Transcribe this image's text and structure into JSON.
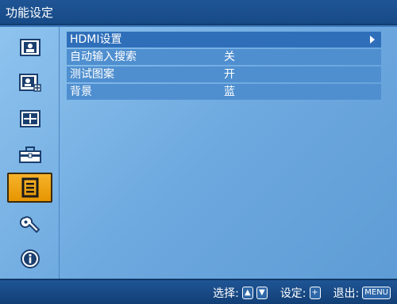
{
  "window": {
    "title": "功能设定"
  },
  "sidebar": {
    "items": [
      {
        "icon": "picture-icon",
        "active": false
      },
      {
        "icon": "picture-adjust-icon",
        "active": false
      },
      {
        "icon": "screen-grid-icon",
        "active": false
      },
      {
        "icon": "toolbox-icon",
        "active": false
      },
      {
        "icon": "function-list-icon",
        "active": true
      },
      {
        "icon": "wrench-icon",
        "active": false
      },
      {
        "icon": "info-icon",
        "active": false
      }
    ]
  },
  "menu": {
    "items": [
      {
        "label": "HDMI设置",
        "value": "",
        "has_submenu": true
      },
      {
        "label": "自动输入搜索",
        "value": "关"
      },
      {
        "label": "测试图案",
        "value": "开"
      },
      {
        "label": "背景",
        "value": "蓝"
      }
    ]
  },
  "footer": {
    "select_label": "选择:",
    "set_label": "设定:",
    "exit_label": "退出:",
    "menu_key": "MENU"
  },
  "colors": {
    "accent_active": "#f0a212",
    "panel": "#6ea9df",
    "title_bar": "#1f5595"
  }
}
